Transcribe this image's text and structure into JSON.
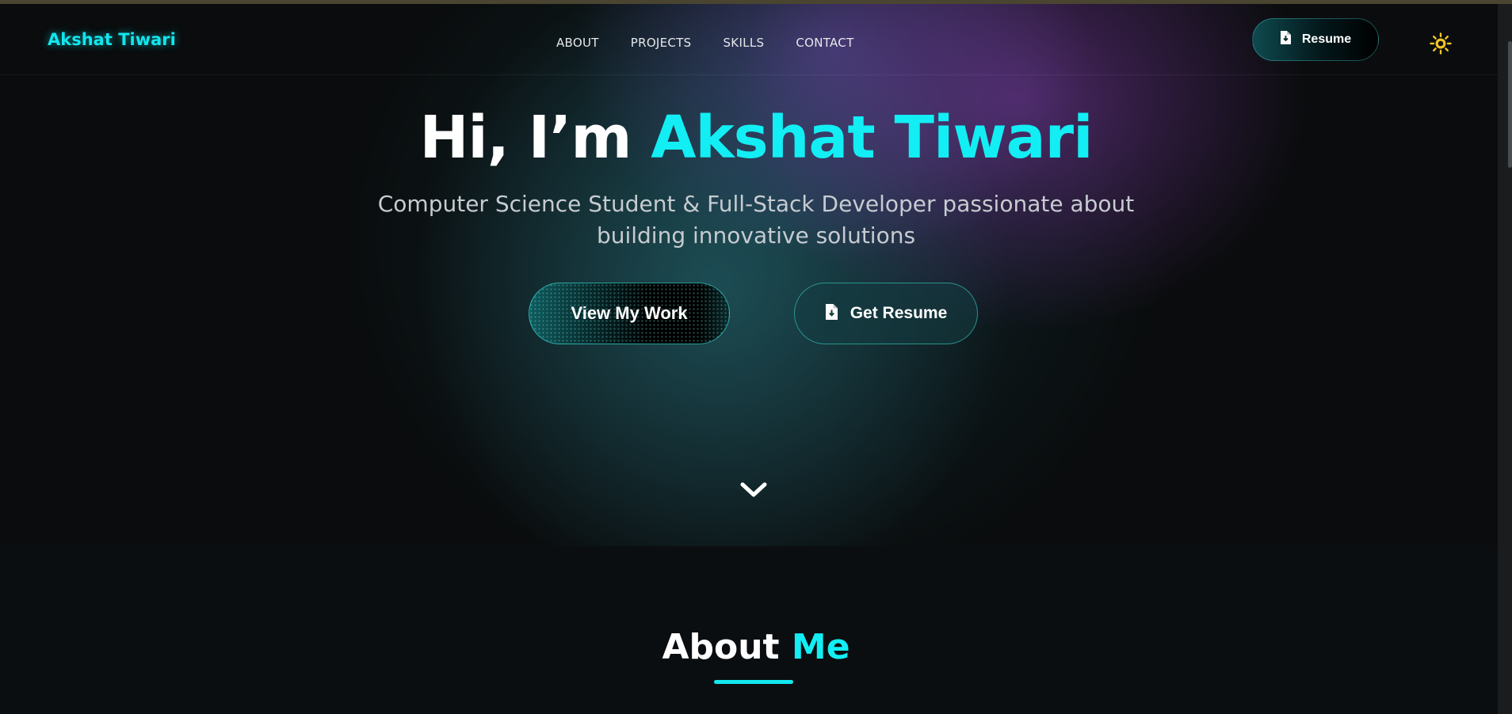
{
  "brand": {
    "name": "Akshat Tiwari"
  },
  "nav": {
    "links": [
      "ABOUT",
      "PROJECTS",
      "SKILLS",
      "CONTACT"
    ],
    "resume_label": "Resume",
    "theme_toggle_icon": "sun-icon"
  },
  "hero": {
    "greeting": "Hi, I’m ",
    "name": "Akshat Tiwari",
    "subtitle": "Computer Science Student & Full-Stack Developer passionate about building innovative solutions",
    "primary_cta": "View My Work",
    "secondary_cta": "Get Resume",
    "scroll_icon": "chevron-down-icon"
  },
  "about": {
    "title_prefix": "About ",
    "title_accent": "Me"
  },
  "colors": {
    "accent": "#12eef4",
    "background": "#0b0d0e",
    "sun": "#f3c623"
  }
}
